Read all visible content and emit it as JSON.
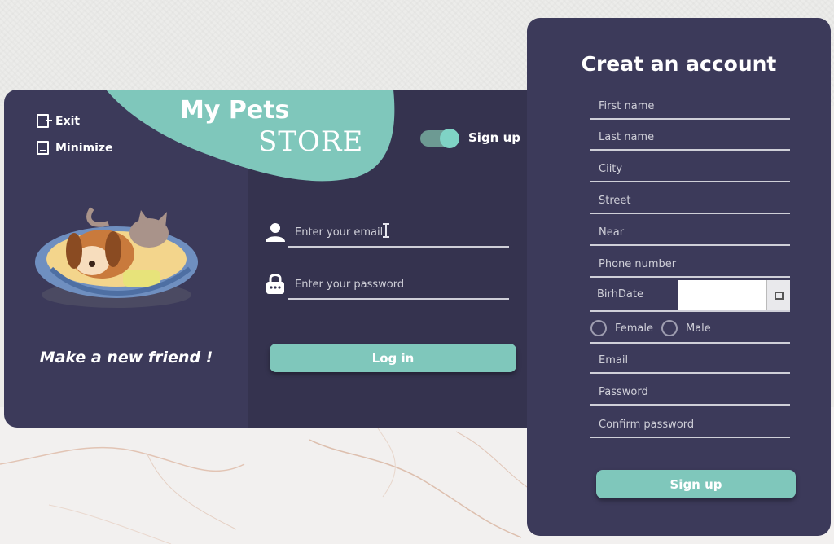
{
  "login": {
    "brand_line1": "My Pets",
    "brand_line2": "STORE",
    "exit_label": "Exit",
    "minimize_label": "Minimize",
    "tagline": "Make a new friend !",
    "toggle_label": "Sign up",
    "toggle_on": true,
    "email_placeholder": "Enter your email",
    "password_placeholder": "Enter your password",
    "login_button": "Log in",
    "accent_color": "#7fc7bb",
    "panel_color": "#3c3a5a"
  },
  "signup": {
    "title": "Creat an account",
    "fields": {
      "first_name": "First name",
      "last_name": "Last name",
      "city": "Ciity",
      "street": "Street",
      "near": "Near",
      "phone": "Phone number",
      "email": "Email",
      "password": "Password",
      "confirm_password": "Confirm password"
    },
    "birthdate_label": "BirhDate",
    "birthdate_value": "",
    "calendar_icon": "calendar-icon",
    "gender_options": [
      "Female",
      "Male"
    ],
    "signup_button": "Sign up"
  }
}
